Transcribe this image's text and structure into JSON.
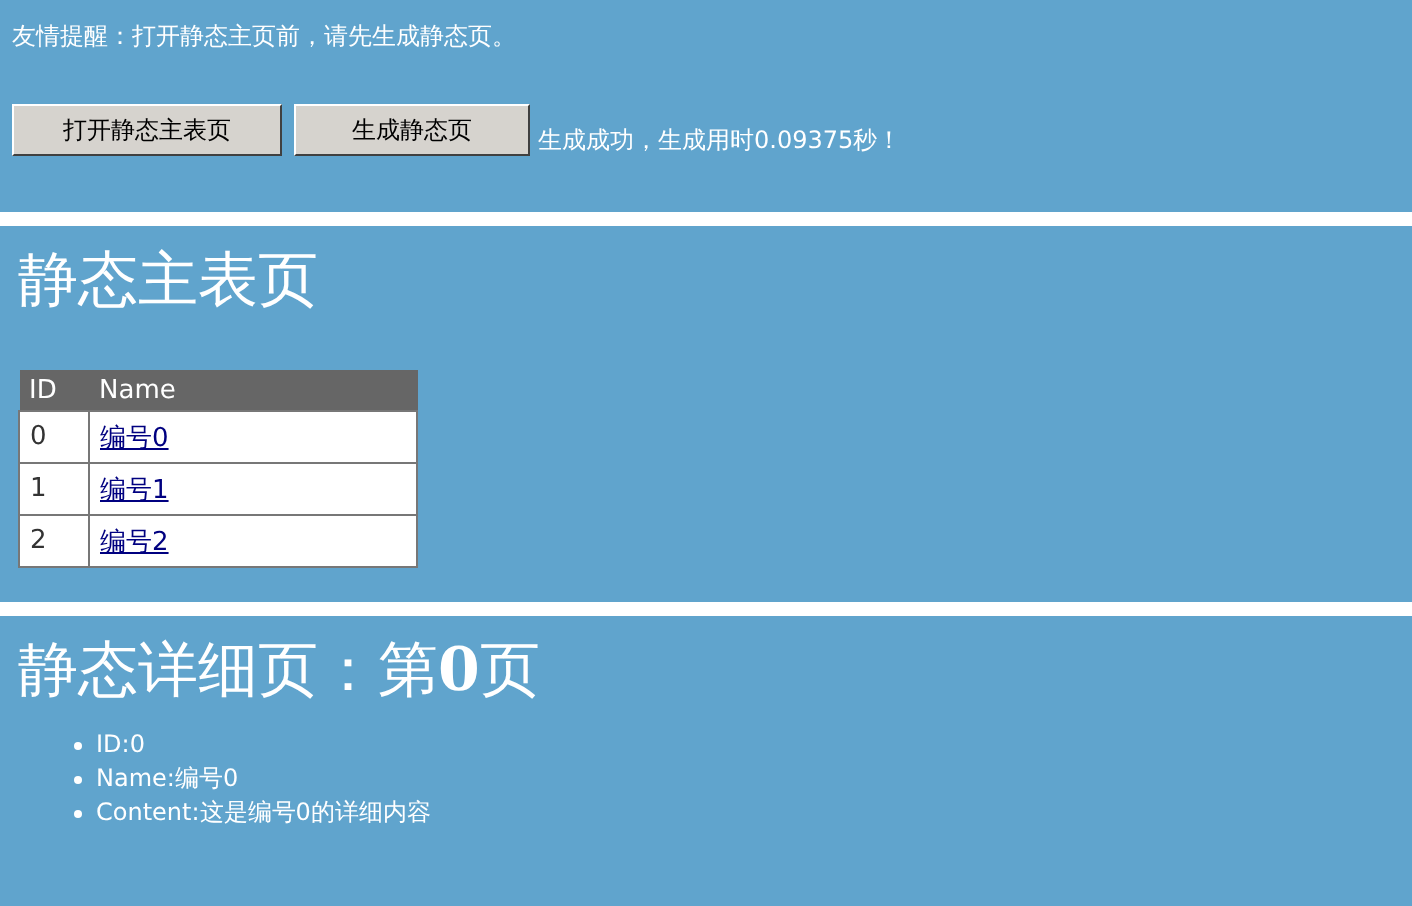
{
  "notice": "友情提醒：打开静态主页前，请先生成静态页。",
  "buttons": [
    "打开静态主表页",
    "生成静态页"
  ],
  "status": "生成成功，生成用时0.09375秒！",
  "index_section": {
    "title": "静态主表页",
    "table": {
      "columns": [
        "ID",
        "Name"
      ],
      "rows": [
        {
          "id": "0",
          "name": "编号0"
        },
        {
          "id": "1",
          "name": "编号1"
        },
        {
          "id": "2",
          "name": "编号2"
        }
      ]
    }
  },
  "detail_section": {
    "title": "静态详细页：第**0**页",
    "items": [
      "ID:0",
      "Name:编号0",
      "Content:这是编号0的详细内容"
    ]
  }
}
